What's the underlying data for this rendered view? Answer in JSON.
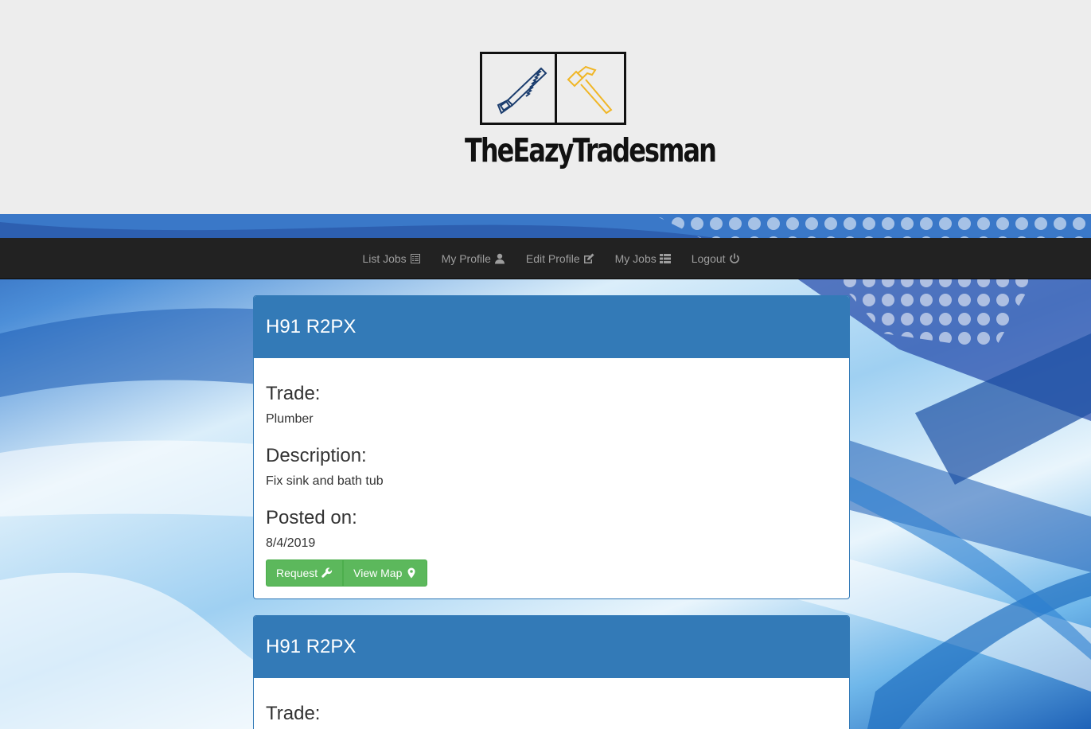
{
  "brand": {
    "name": "TheEazyTradesman"
  },
  "nav": {
    "items": [
      {
        "label": "List Jobs",
        "icon": "list-alt-icon"
      },
      {
        "label": "My Profile",
        "icon": "user-icon"
      },
      {
        "label": "Edit Profile",
        "icon": "edit-icon"
      },
      {
        "label": "My Jobs",
        "icon": "th-list-icon"
      },
      {
        "label": "Logout",
        "icon": "power-off-icon"
      }
    ]
  },
  "colors": {
    "navbar": "#222222",
    "panel_header": "#337ab7",
    "button": "#5cb85c"
  },
  "jobs": [
    {
      "title": "H91 R2PX",
      "trade_label": "Trade:",
      "trade": "Plumber",
      "description_label": "Description:",
      "description": "Fix sink and bath tub",
      "posted_label": "Posted on:",
      "posted": "8/4/2019",
      "request_label": "Request",
      "map_label": "View Map"
    },
    {
      "title": "H91 R2PX",
      "trade_label": "Trade:"
    }
  ]
}
